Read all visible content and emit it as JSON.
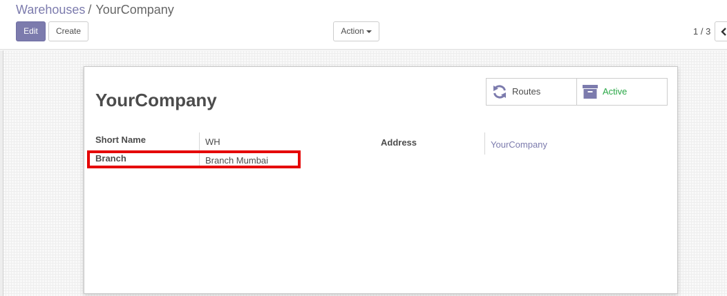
{
  "breadcrumb": {
    "parent": "Warehouses",
    "separator": "/",
    "current": "YourCompany"
  },
  "toolbar": {
    "edit_label": "Edit",
    "create_label": "Create",
    "action_label": "Action"
  },
  "pager": {
    "value": "1 / 3"
  },
  "stat_buttons": {
    "routes": {
      "label": "Routes",
      "icon": "refresh-icon"
    },
    "active": {
      "label": "Active",
      "icon": "archive-icon",
      "color": "#28a745"
    }
  },
  "record": {
    "title": "YourCompany",
    "fields": {
      "short_name": {
        "label": "Short Name",
        "value": "WH"
      },
      "branch": {
        "label": "Branch",
        "value": "Branch Mumbai"
      },
      "address": {
        "label": "Address",
        "value": "YourCompany"
      }
    }
  },
  "colors": {
    "accent": "#7c7bad",
    "highlight": "#e50000",
    "active": "#28a745"
  }
}
